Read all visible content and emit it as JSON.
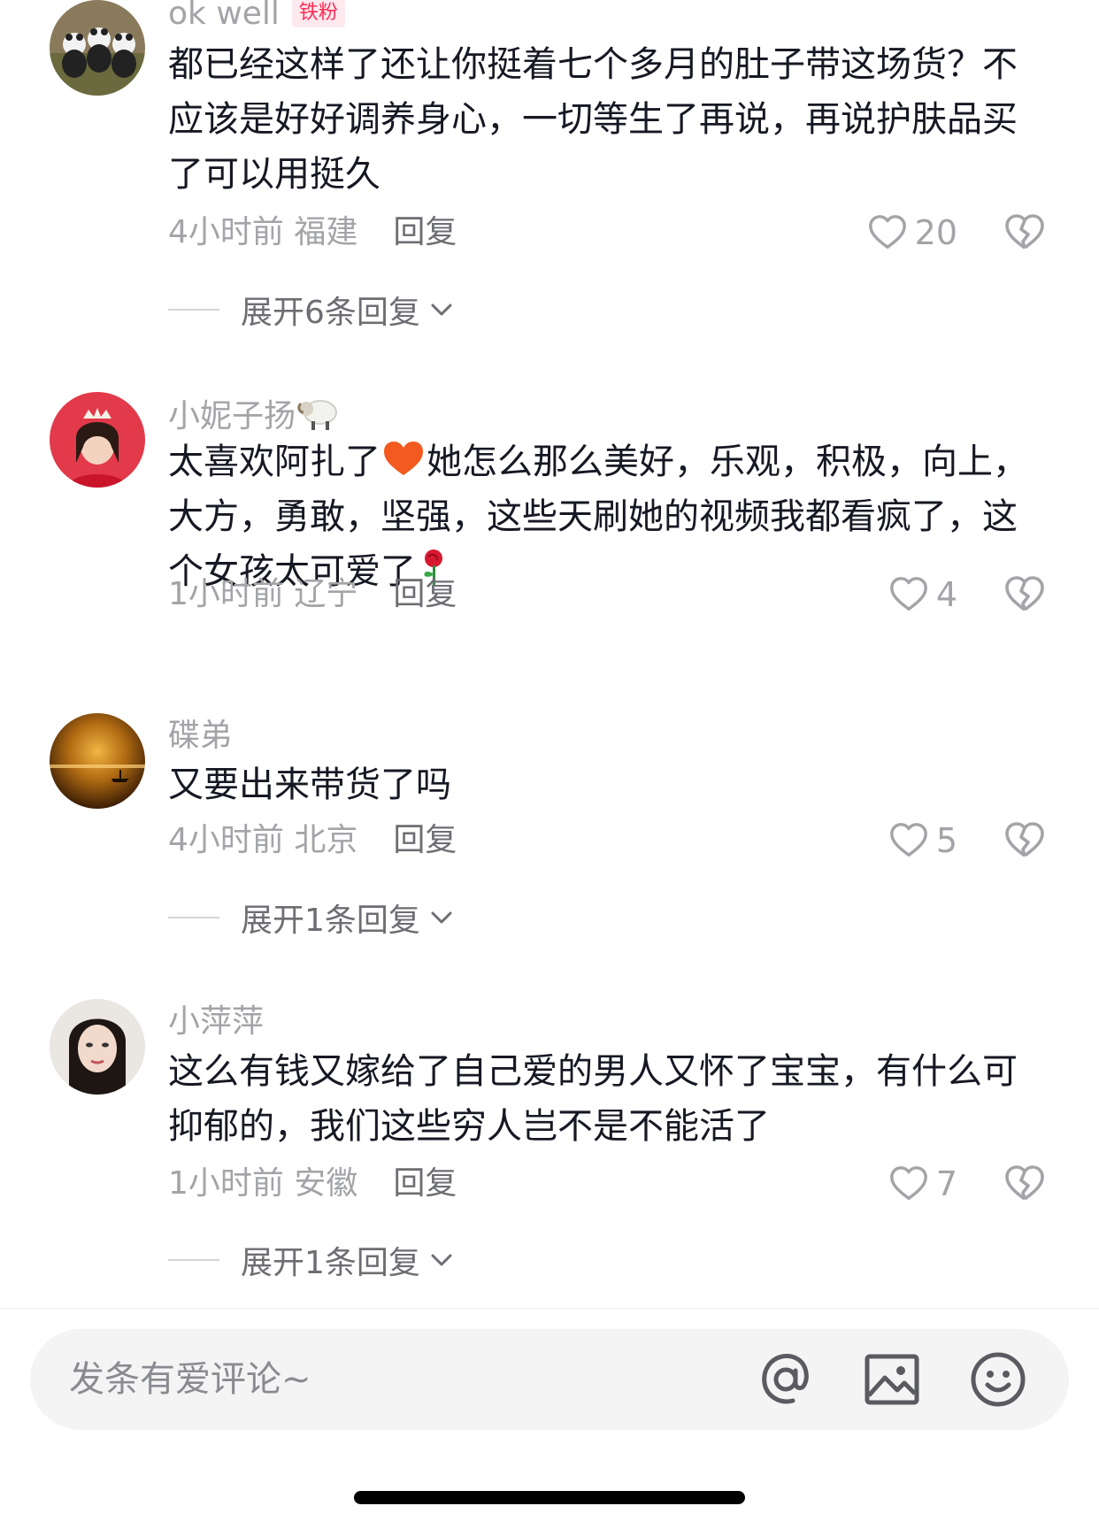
{
  "comments": [
    {
      "username": "ok well",
      "badge": "铁粉",
      "text": "都已经这样了还让你挺着七个多月的肚子带这场货？不应该是好好调养身心，一切等生了再说，再说护肤品买了可以用挺久",
      "time_location": "4小时前 福建",
      "reply_label": "回复",
      "likes": "20",
      "expand_label": "展开6条回复"
    },
    {
      "username": "小妮子扬",
      "username_emoji": "sheep-emoji",
      "text_part1": "太喜欢阿扎了",
      "text_part2": "她怎么那么美好，乐观，积极，向上，大方，勇敢，坚强，这些天刷她的视频我都看疯了，这个女孩太可爱了",
      "time_location": "1小时前 辽宁",
      "reply_label": "回复",
      "likes": "4"
    },
    {
      "username": "碟弟",
      "text": "又要出来带货了吗",
      "time_location": "4小时前 北京",
      "reply_label": "回复",
      "likes": "5",
      "expand_label": "展开1条回复"
    },
    {
      "username": "小萍萍",
      "text": "这么有钱又嫁给了自己爱的男人又怀了宝宝，有什么可抑郁的，我们这些穷人岂不是不能活了",
      "time_location": "1小时前 安徽",
      "reply_label": "回复",
      "likes": "7",
      "expand_label": "展开1条回复"
    }
  ],
  "input": {
    "placeholder": "发条有爱评论~",
    "icons": [
      "at-icon",
      "image-icon",
      "emoji-icon"
    ]
  },
  "colors": {
    "badge_bg": "#fde9ee",
    "badge_text": "#fe2c55",
    "secondary_text": "#a3a4a8",
    "primary_text": "#161823"
  }
}
